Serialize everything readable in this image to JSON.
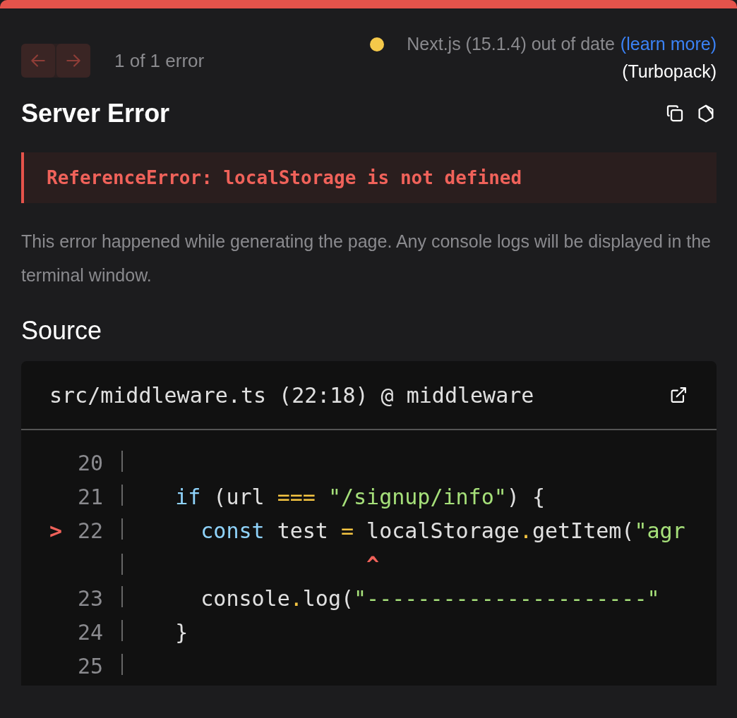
{
  "nav": {
    "counter": "1 of 1 error"
  },
  "version": {
    "text": "Next.js (15.1.4) out of date",
    "link": "(learn more)",
    "bundler": "(Turbopack)"
  },
  "title": "Server Error",
  "error_message": "ReferenceError: localStorage is not defined",
  "description": "This error happened while generating the page. Any console logs will be displayed in the terminal window.",
  "source": {
    "heading": "Source",
    "file": "src/middleware.ts (22:18) @ middleware",
    "lines": [
      {
        "kind": "code",
        "number": "20"
      },
      {
        "kind": "code",
        "number": "21",
        "tokens": [
          {
            "text": "   if",
            "kind": "keyword"
          },
          {
            "text": " (url ",
            "kind": "plain"
          },
          {
            "text": "===",
            "kind": "operator"
          },
          {
            "text": " \"/signup/info\"",
            "kind": "string"
          },
          {
            "text": ") {",
            "kind": "plain"
          }
        ]
      },
      {
        "kind": "code",
        "number": "22",
        "marker": ">",
        "tokens": [
          {
            "text": "     const",
            "kind": "keyword"
          },
          {
            "text": " test ",
            "kind": "plain"
          },
          {
            "text": "=",
            "kind": "operator"
          },
          {
            "text": " localStorage",
            "kind": "plain"
          },
          {
            "text": ".",
            "kind": "operator"
          },
          {
            "text": "getItem(",
            "kind": "plain"
          },
          {
            "text": "\"agr",
            "kind": "string"
          }
        ]
      },
      {
        "kind": "caret",
        "tokens": [
          {
            "text": "                  ^",
            "kind": "caret"
          }
        ]
      },
      {
        "kind": "code",
        "number": "23",
        "tokens": [
          {
            "text": "     console",
            "kind": "plain"
          },
          {
            "text": ".",
            "kind": "operator"
          },
          {
            "text": "log(",
            "kind": "plain"
          },
          {
            "text": "\"----------------------\"",
            "kind": "string"
          }
        ]
      },
      {
        "kind": "code",
        "number": "24",
        "tokens": [
          {
            "text": "   }",
            "kind": "plain"
          }
        ]
      },
      {
        "kind": "code",
        "number": "25"
      }
    ]
  }
}
